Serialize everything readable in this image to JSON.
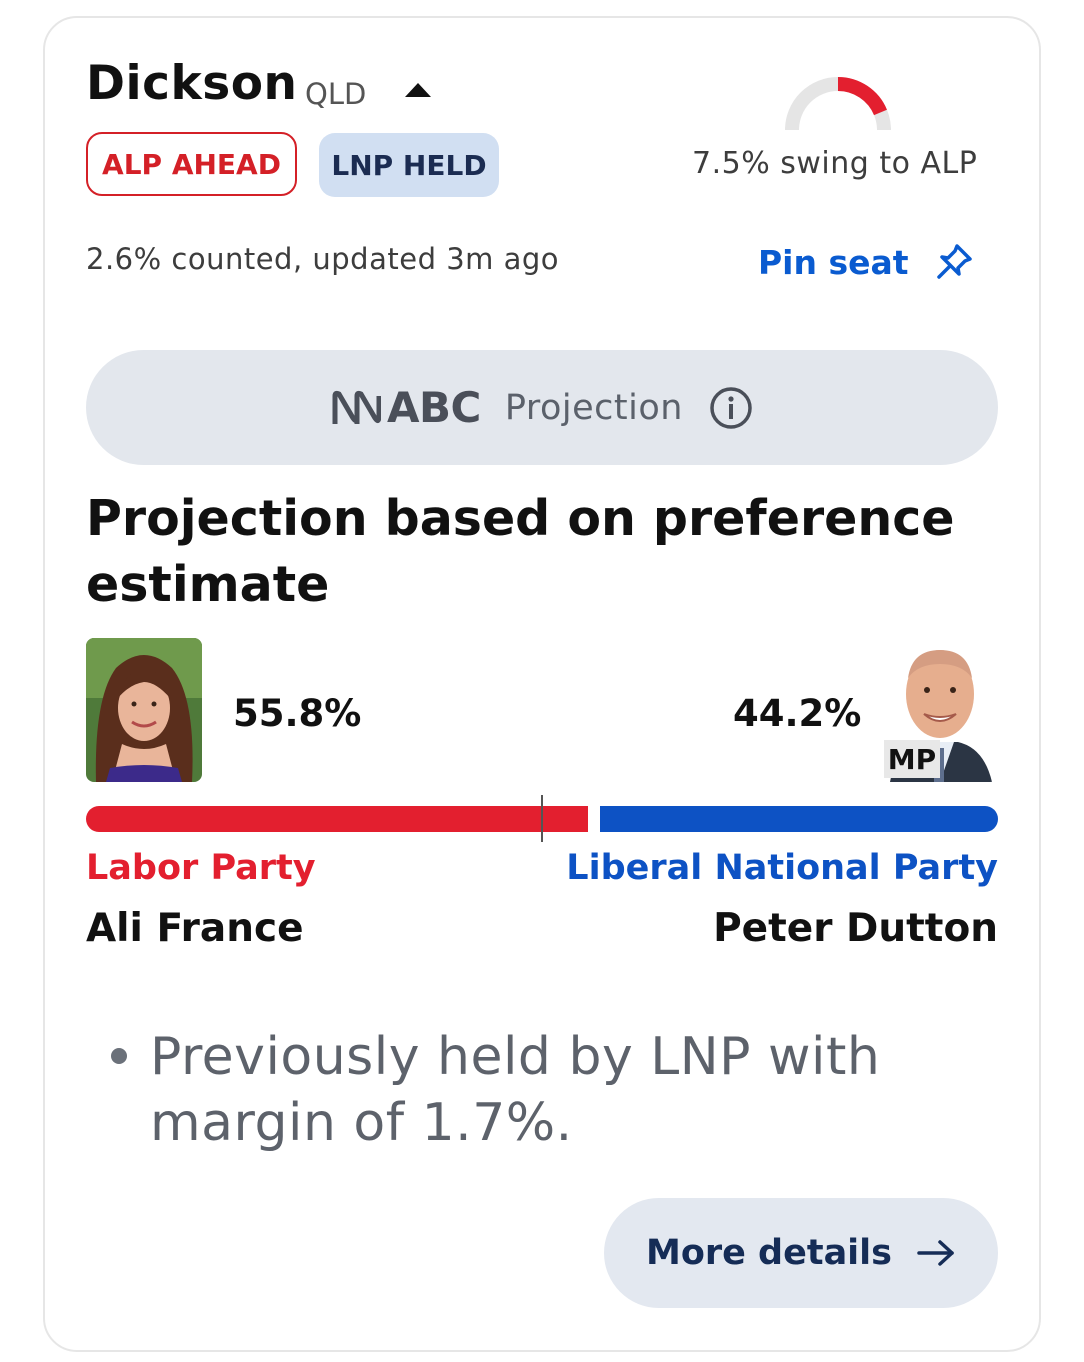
{
  "seat": {
    "name": "Dickson",
    "state": "QLD",
    "status_badge": "ALP AHEAD",
    "held_badge": "LNP HELD",
    "swing_text": "7.5% swing to ALP",
    "swing_gauge_fraction": 0.3,
    "counted_text": "2.6% counted, updated 3m ago",
    "pin_label": "Pin seat"
  },
  "projection": {
    "brand": "ABC",
    "label": "Projection",
    "heading": "Projection based on preference estimate"
  },
  "candidates": {
    "left": {
      "percent": "55.8%",
      "party": "Labor Party",
      "name": "Ali France",
      "bar_share": 55.8
    },
    "right": {
      "percent": "44.2%",
      "party": "Liberal National Party",
      "name": "Peter Dutton",
      "tag": "MP",
      "bar_share": 44.2
    }
  },
  "note": "Previously held by LNP with margin of 1.7%.",
  "more_button": "More details",
  "colors": {
    "alp_red": "#e31f2f",
    "lnp_blue": "#0d52c4",
    "link_blue": "#0a5bd0",
    "held_badge_bg": "#d1dff2"
  },
  "icons": [
    "chevron-up-icon",
    "pin-icon",
    "abc-logo-icon",
    "info-icon",
    "arrow-right-icon"
  ]
}
